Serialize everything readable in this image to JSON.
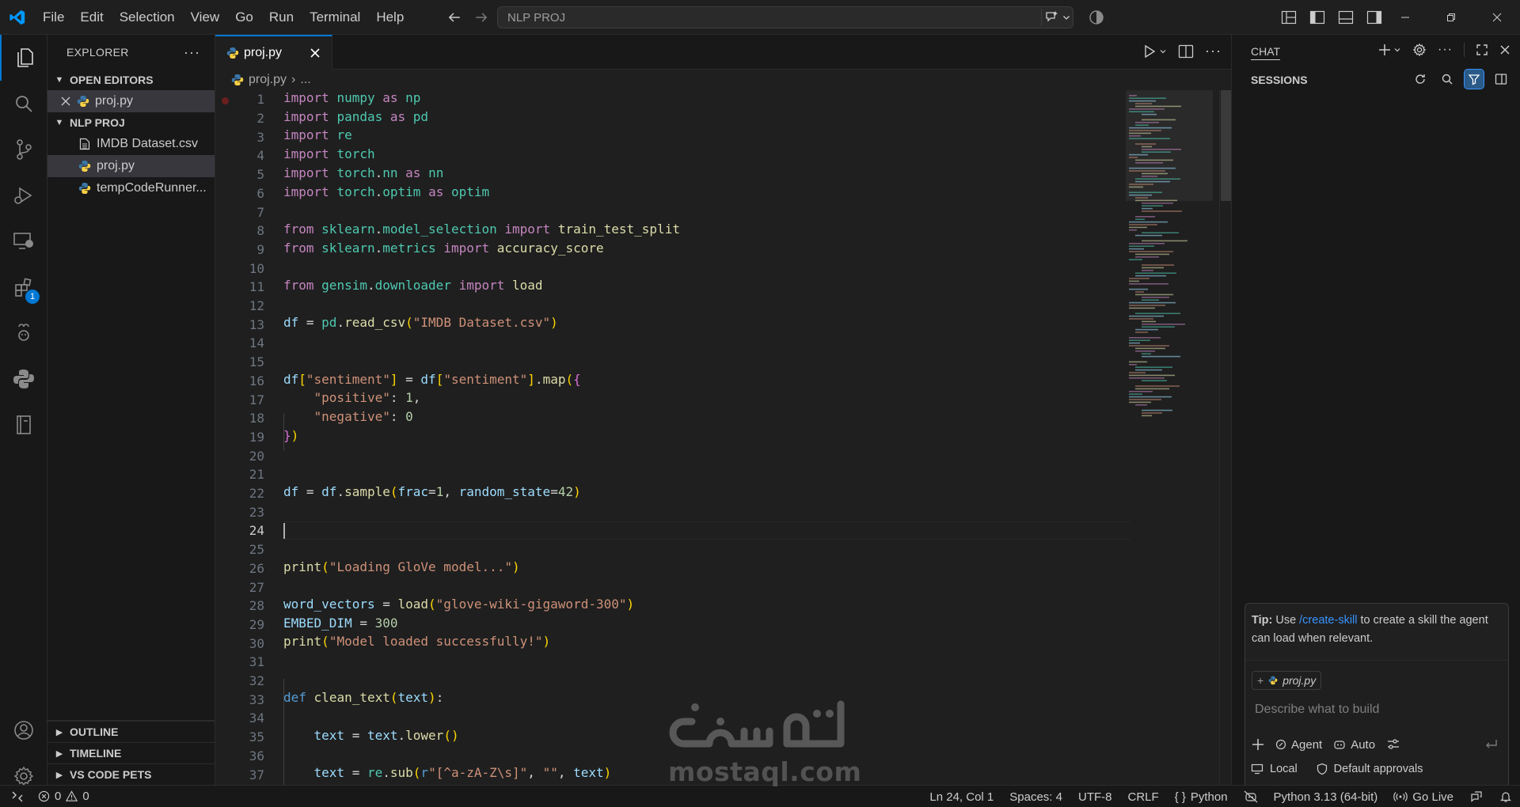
{
  "menu": [
    "File",
    "Edit",
    "Selection",
    "View",
    "Go",
    "Run",
    "Terminal",
    "Help"
  ],
  "command_center": {
    "text": "NLP PROJ"
  },
  "explorer": {
    "title": "EXPLORER",
    "open_editors_label": "OPEN EDITORS",
    "open_editors": [
      {
        "name": "proj.py"
      }
    ],
    "folder_label": "NLP PROJ",
    "files": [
      {
        "name": "IMDB Dataset.csv",
        "icon": "file-lines-icon"
      },
      {
        "name": "proj.py",
        "icon": "python-icon"
      },
      {
        "name": "tempCodeRunner...",
        "icon": "python-icon"
      }
    ],
    "bottom_sections": [
      "OUTLINE",
      "TIMELINE",
      "VS CODE PETS"
    ]
  },
  "activity": {
    "extensions_badge": "1"
  },
  "tab": {
    "label": "proj.py"
  },
  "breadcrumb": {
    "file": "proj.py",
    "more": "..."
  },
  "editor": {
    "line_numbers": [
      "1",
      "2",
      "3",
      "4",
      "5",
      "6",
      "7",
      "8",
      "9",
      "10",
      "11",
      "12",
      "13",
      "14",
      "15",
      "16",
      "17",
      "18",
      "19",
      "20",
      "21",
      "22",
      "23",
      "24",
      "25",
      "26",
      "27",
      "28",
      "29",
      "30",
      "31",
      "32",
      "33",
      "34",
      "35",
      "36",
      "37"
    ],
    "current_line": 24
  },
  "chat": {
    "title": "CHAT",
    "sessions_label": "SESSIONS",
    "tip_prefix": "Tip:",
    "tip_pre": " Use ",
    "tip_link": "/create-skill",
    "tip_post": " to create a skill the agent can load when relevant.",
    "context_file": "proj.py",
    "input_placeholder": "Describe what to build",
    "agent_label": "Agent",
    "auto_label": "Auto",
    "footer_local": "Local",
    "footer_approvals": "Default approvals"
  },
  "status": {
    "errors": "0",
    "warnings": "0",
    "position": "Ln 24, Col 1",
    "spaces": "Spaces: 4",
    "encoding": "UTF-8",
    "eol": "CRLF",
    "language": "Python",
    "interpreter": "Python 3.13 (64-bit)",
    "golive": "Go Live"
  },
  "watermark": {
    "latin": "mostaql.com",
    "arabic": "مستقل"
  },
  "colors": {
    "accent": "#0078d4",
    "background": "#1f1f1f",
    "sidebar": "#181818",
    "keyword": "#c586c0",
    "string": "#ce9178",
    "module": "#4ec9b0",
    "function": "#dcdcaa"
  }
}
